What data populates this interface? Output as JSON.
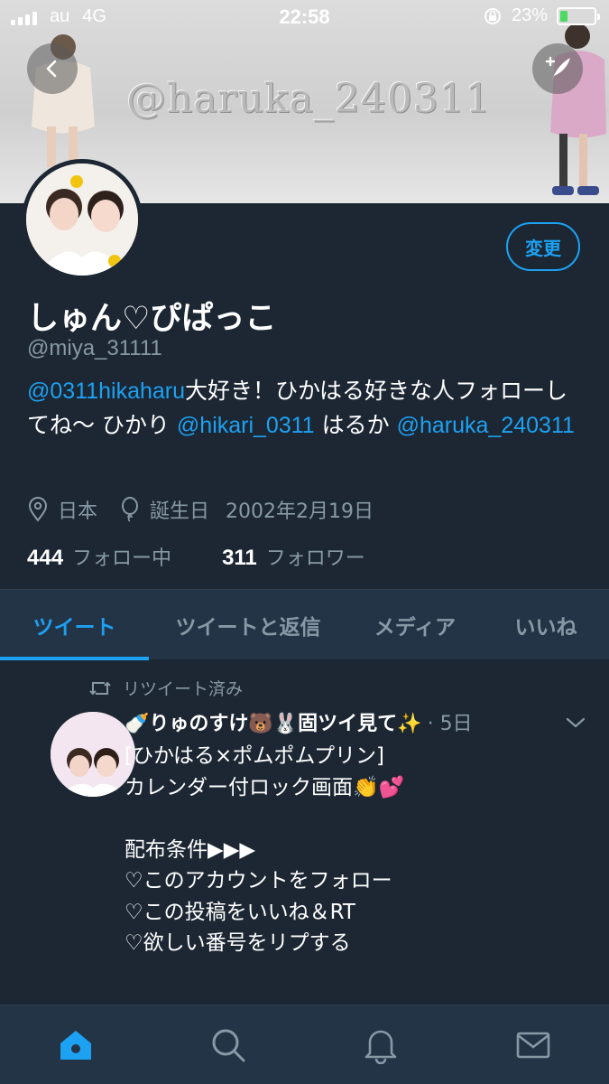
{
  "status_bar": {
    "carrier": "au",
    "network": "4G",
    "time": "22:58",
    "battery": "23%",
    "battery_level": 0.23
  },
  "banner": {
    "watermark": "@haruka_240311"
  },
  "profile": {
    "edit_button": "変更",
    "name": "しゅん♡ぴぱっこ",
    "handle": "@miya_31111",
    "bio": {
      "mention1": "@0311hikaharu",
      "text1": "大好き！ひかはる好きな人フォローしてね〜 ひかり ",
      "mention2": "@hikari_0311",
      "text2": " はるか ",
      "mention3": "@haruka_240311"
    },
    "location": "日本",
    "birthday_label": "誕生日",
    "birthday": "2002年2月19日",
    "following_count": "444",
    "following_label": "フォロー中",
    "followers_count": "311",
    "followers_label": "フォロワー"
  },
  "tabs": [
    {
      "label": "ツイート",
      "active": true
    },
    {
      "label": "ツイートと返信",
      "active": false
    },
    {
      "label": "メディア",
      "active": false
    },
    {
      "label": "いいね",
      "active": false
    }
  ],
  "tweet": {
    "retweet_label": "リツイート済み",
    "author": "🍼りゅのすけ🐻🐰固ツイ見て✨",
    "time": "· 5日",
    "body": "[ひかはる×ポムポムプリン]\nカレンダー付ロック画面👏💕\n\n配布条件▶▶▶\n♡このアカウントをフォロー\n♡この投稿をいいね＆RT\n♡欲しい番号をリプする"
  },
  "colors": {
    "background": "#1c2733",
    "surface": "#243447",
    "accent": "#1da1f2",
    "muted": "#8899a6"
  },
  "icons": [
    "back-icon",
    "compose-icon",
    "location-pin-icon",
    "balloon-icon",
    "retweet-icon",
    "chevron-down-icon",
    "home-icon",
    "search-icon",
    "bell-icon",
    "mail-icon"
  ]
}
